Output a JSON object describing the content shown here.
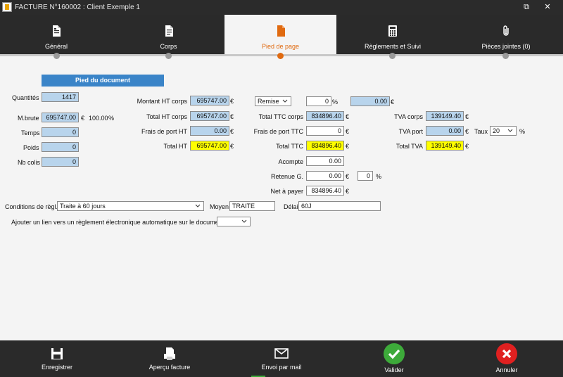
{
  "window": {
    "title": "FACTURE N°160002 : Client Exemple 1",
    "restore_glyph": "⧉",
    "close_glyph": "✕"
  },
  "tabs": [
    {
      "label": "Général",
      "icon": "document-lines-icon"
    },
    {
      "label": "Corps",
      "icon": "document-text-icon"
    },
    {
      "label": "Pied de page",
      "icon": "document-filled-icon",
      "active": true
    },
    {
      "label": "Règlements et Suivi",
      "icon": "calculator-icon"
    },
    {
      "label": "Pièces jointes (0)",
      "icon": "paperclip-icon"
    }
  ],
  "section": {
    "header": "Pied du document"
  },
  "left": {
    "quantites_label": "Quantités",
    "quantites": "1417",
    "mbrute_label": "M.brute",
    "mbrute": "695747.00",
    "mbrute_unit": "€",
    "mbrute_pct": "100.00",
    "pct_unit": "%",
    "temps_label": "Temps",
    "temps": "0",
    "poids_label": "Poids",
    "poids": "0",
    "nbcolis_label": "Nb colis",
    "nbcolis": "0"
  },
  "col2": {
    "montant_ht_corps_label": "Montant HT corps",
    "montant_ht_corps": "695747.00",
    "total_ht_corps_label": "Total HT corps",
    "total_ht_corps": "695747.00",
    "frais_port_ht_label": "Frais de port HT",
    "frais_port_ht": "0.00",
    "total_ht_label": "Total HT",
    "total_ht": "695747.00",
    "euro": "€"
  },
  "col3": {
    "remise_select": "Remise",
    "remise_pct": "0",
    "remise_pct_unit": "%",
    "remise_amount": "0.00",
    "total_ttc_corps_label": "Total TTC corps",
    "total_ttc_corps": "834896.40",
    "frais_port_ttc_label": "Frais de port TTC",
    "frais_port_ttc": "0",
    "total_ttc_label": "Total TTC",
    "total_ttc": "834896.40",
    "acompte_label": "Acompte",
    "acompte": "0.00",
    "retenue_label": "Retenue G.",
    "retenue": "0.00",
    "retenue_pct": "0",
    "retenue_pct_unit": "%",
    "net_label": "Net à payer",
    "net": "834896.40",
    "euro": "€"
  },
  "col4": {
    "tva_corps_label": "TVA corps",
    "tva_corps": "139149.40",
    "tva_port_label": "TVA port",
    "tva_port": "0.00",
    "taux_label": "Taux",
    "taux_value": "20",
    "taux_unit": "%",
    "total_tva_label": "Total TVA",
    "total_tva": "139149.40",
    "euro": "€"
  },
  "conditions": {
    "label": "Conditions de règl.",
    "value": "Traite à 60 jours",
    "moyen_label": "Moyen",
    "moyen_value": "TRAITE",
    "delai_label": "Délai",
    "delai_value": "60J",
    "lien_label": "Ajouter un lien vers un règlement électronique automatique sur le document",
    "lien_value": ""
  },
  "bottom": {
    "enregistrer": "Enregistrer",
    "apercu": "Aperçu facture",
    "envoi": "Envoi par mail",
    "valider": "Valider",
    "annuler": "Annuler"
  },
  "colors": {
    "accent": "#e06a10",
    "field_blue": "#b8d4ec",
    "field_yellow": "#ffff00",
    "header_blue": "#3a84c8",
    "ok_green": "#3daa3a",
    "cancel_red": "#e02020"
  }
}
